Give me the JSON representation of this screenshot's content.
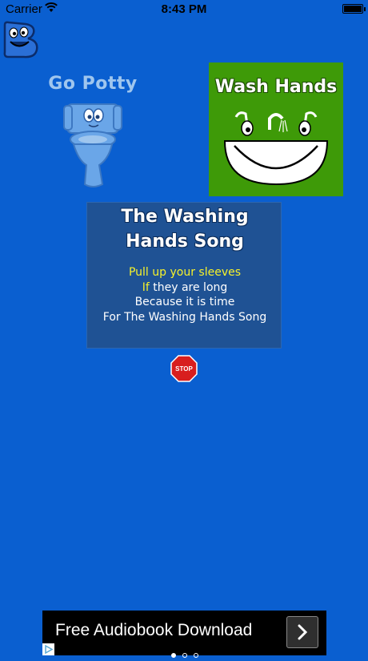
{
  "status_bar": {
    "carrier": "Carrier",
    "time": "8:43 PM"
  },
  "tiles": {
    "go_potty": "Go Potty",
    "wash_hands": "Wash Hands"
  },
  "song": {
    "title_line1": "The Washing",
    "title_line2": "Hands Song",
    "lyrics": [
      {
        "prefix": "",
        "highlight": "Pull up your sleeves",
        "rest": ""
      },
      {
        "prefix": "",
        "highlight": "If",
        "rest": " they are long"
      },
      {
        "prefix": "Because it is time",
        "highlight": "",
        "rest": ""
      },
      {
        "prefix": "For The Washing Hands Song",
        "highlight": "",
        "rest": ""
      }
    ]
  },
  "stop_button": {
    "label": "STOP"
  },
  "ad": {
    "text": "Free Audiobook Download",
    "pages": 3,
    "active_page": 1
  },
  "colors": {
    "background": "#0a5fd0",
    "wash_tile": "#3e9a08",
    "song_card": "#1f5294",
    "highlight": "#f7f22a",
    "stop": "#d81e1e"
  }
}
